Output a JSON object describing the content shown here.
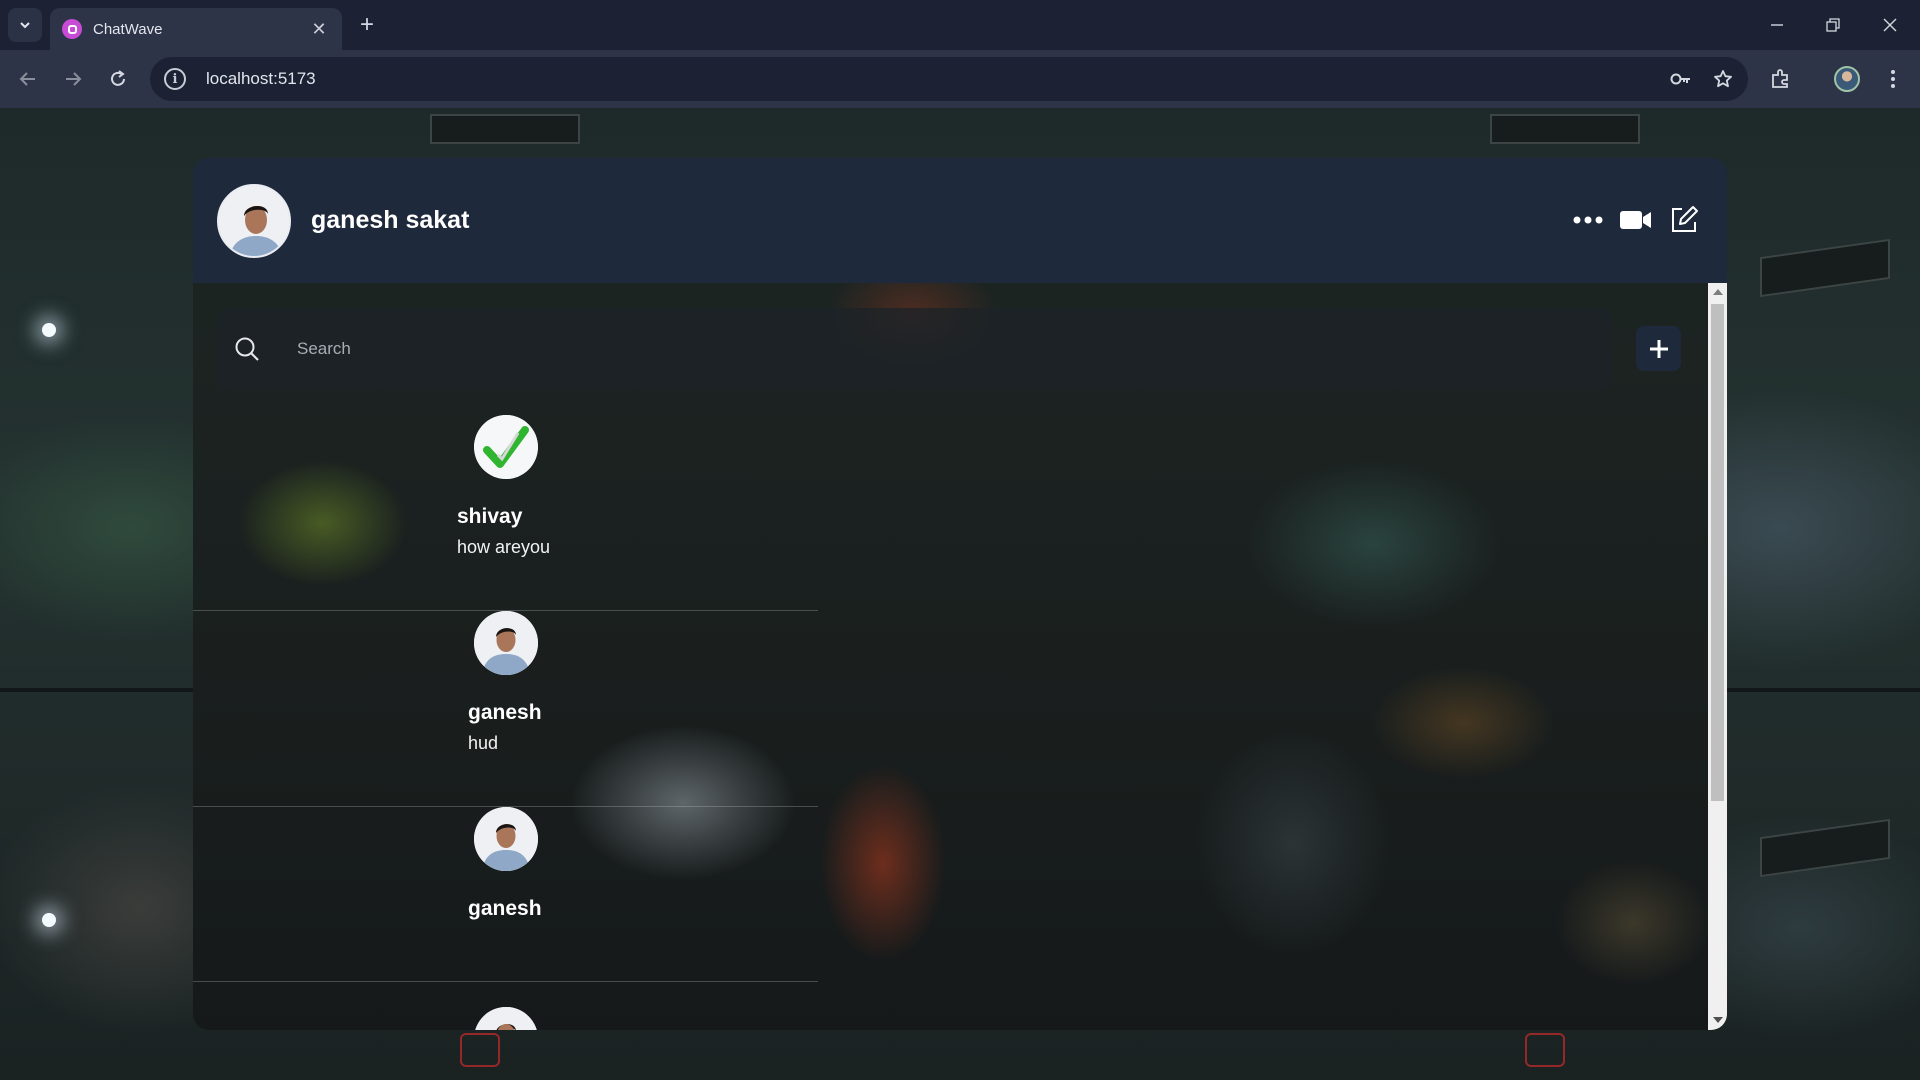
{
  "browser": {
    "tab_title": "ChatWave",
    "tab_close": "✕",
    "new_tab": "+",
    "url": "localhost:5173"
  },
  "header": {
    "user_name": "ganesh sakat",
    "icons": [
      "more-options-icon",
      "video-call-icon",
      "edit-icon"
    ]
  },
  "search": {
    "placeholder": "Search",
    "value": ""
  },
  "add_button": {
    "icon": "plus-icon"
  },
  "chats": [
    {
      "name": "shivay",
      "last_message": "how areyou",
      "avatar": "checkmark-avatar"
    },
    {
      "name": "ganesh",
      "last_message": "hud",
      "avatar": "person-avatar"
    },
    {
      "name": "ganesh",
      "last_message": "",
      "avatar": "person-avatar"
    }
  ],
  "colors": {
    "header_bg": "#1e293b",
    "chrome_bg": "#2e3447",
    "tabstrip_bg": "#1c2133",
    "check_green": "#2fb52f"
  }
}
